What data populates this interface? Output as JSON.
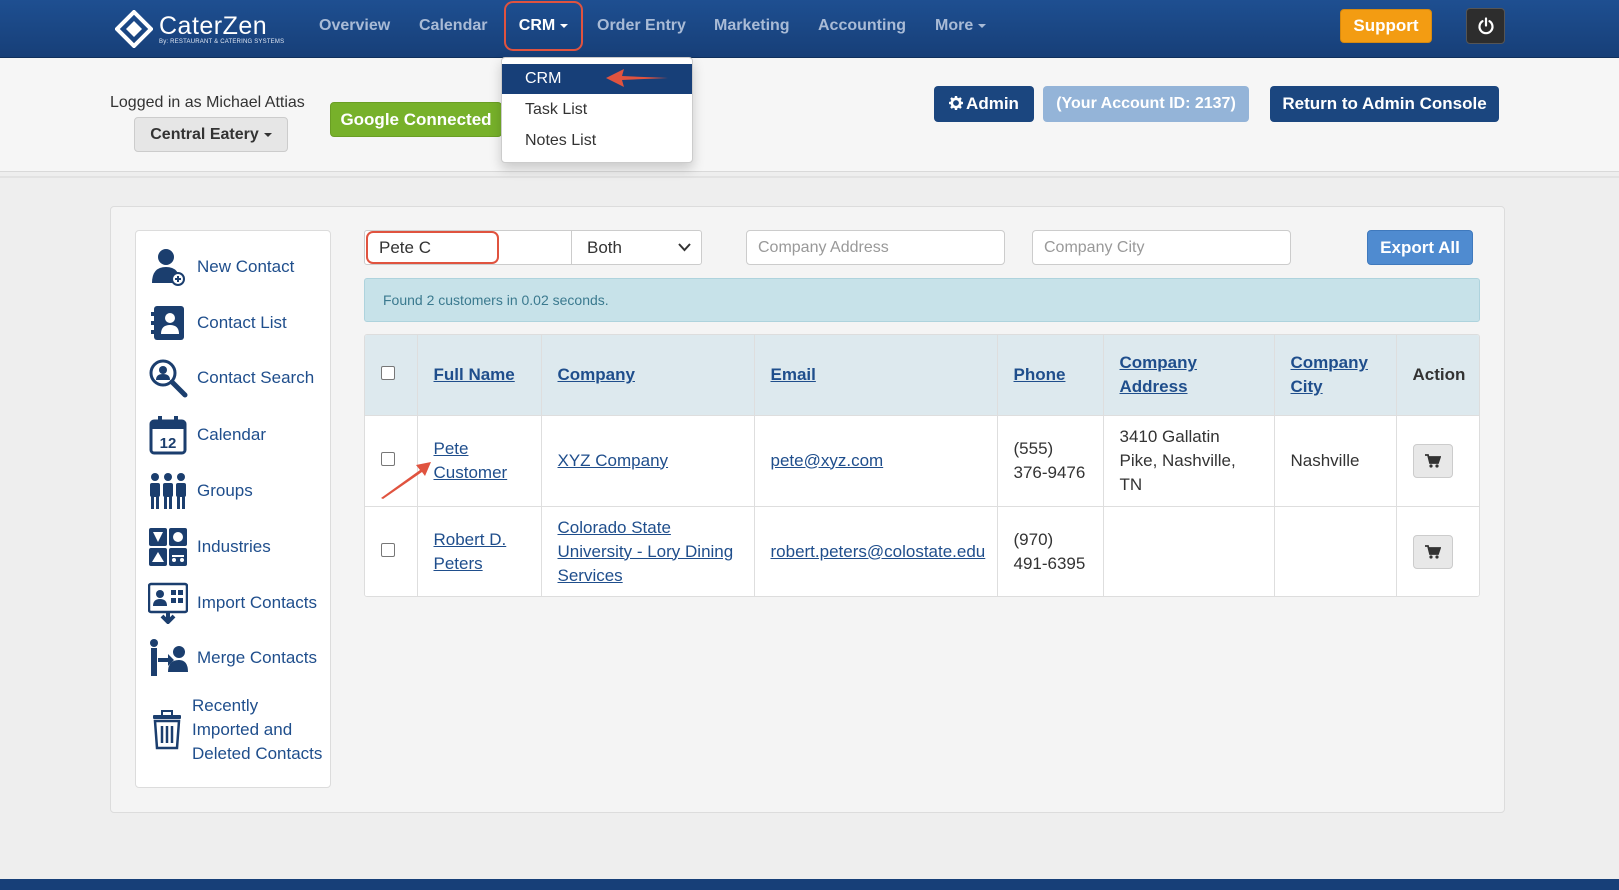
{
  "brand": {
    "name": "CaterZen",
    "tagline": "By: RESTAURANT & CATERING SYSTEMS"
  },
  "nav": {
    "items": [
      "Overview",
      "Calendar",
      "CRM",
      "Order Entry",
      "Marketing",
      "Accounting",
      "More"
    ],
    "active": "CRM",
    "support_label": "Support"
  },
  "crm_dropdown": {
    "items": [
      "CRM",
      "Task List",
      "Notes List"
    ],
    "active": "CRM"
  },
  "header": {
    "logged_in": "Logged in as Michael Attias",
    "location": "Central Eatery",
    "google_status": "Google Connected",
    "admin_label": "Admin",
    "account_label": "(Your Account ID: 2137)",
    "return_label": "Return to Admin Console"
  },
  "sidebar": {
    "items": [
      {
        "label": "New Contact",
        "icon": "new-contact-icon"
      },
      {
        "label": "Contact List",
        "icon": "contact-list-icon"
      },
      {
        "label": "Contact Search",
        "icon": "search-icon"
      },
      {
        "label": "Calendar",
        "icon": "calendar-icon"
      },
      {
        "label": "Groups",
        "icon": "groups-icon"
      },
      {
        "label": "Industries",
        "icon": "industries-icon"
      },
      {
        "label": "Import Contacts",
        "icon": "import-icon"
      },
      {
        "label": "Merge Contacts",
        "icon": "merge-icon"
      },
      {
        "label": "Recently Imported and Deleted Contacts",
        "lines": [
          "Recently",
          "Imported and",
          "Deleted Contacts"
        ],
        "icon": "trash-icon"
      }
    ],
    "calendar_day": "12"
  },
  "search": {
    "name_value": "Pete C",
    "scope_value": "Both",
    "address_placeholder": "Company Address",
    "city_placeholder": "Company City",
    "export_label": "Export All"
  },
  "results_message": "Found 2 customers in 0.02 seconds.",
  "table": {
    "headers": [
      "Full Name",
      "Company",
      "Email",
      "Phone",
      "Company Address",
      "Company City",
      "Action"
    ],
    "rows": [
      {
        "name": "Pete Customer",
        "company": "XYZ Company",
        "email": "pete@xyz.com",
        "phone": "(555) 376-9476",
        "address": "3410 Gallatin Pike, Nashville, TN",
        "city": "Nashville"
      },
      {
        "name": "Robert D. Peters",
        "company": "Colorado State University - Lory Dining Services",
        "email": "robert.peters@colostate.edu",
        "phone": "(970) 491-6395",
        "address": "",
        "city": ""
      }
    ]
  },
  "colors": {
    "navbar": "#1e4f91",
    "accent_red": "#e0533f",
    "support": "#f39c12",
    "google": "#77b12a",
    "link": "#1f4e8c"
  }
}
